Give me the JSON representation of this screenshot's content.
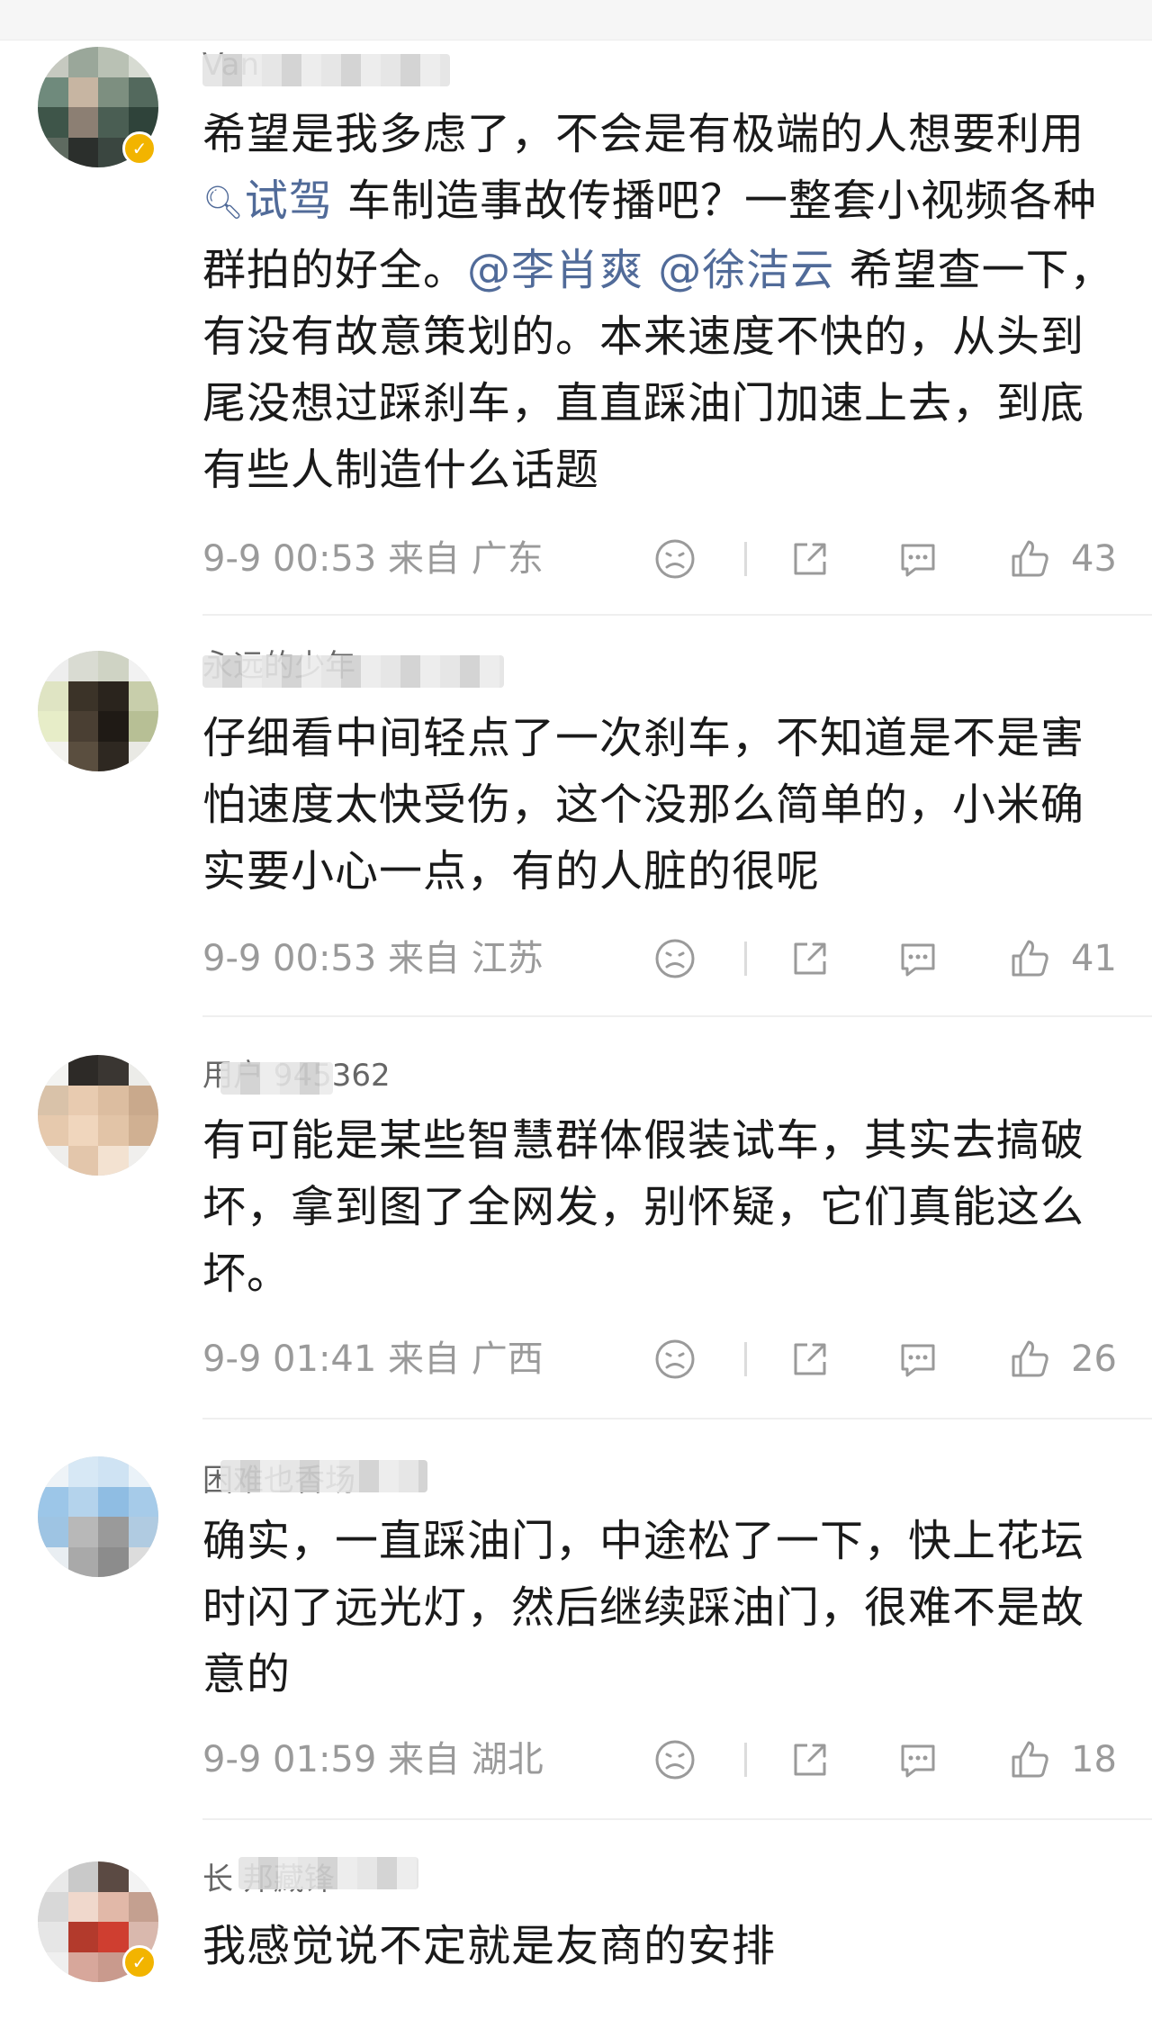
{
  "comments": [
    {
      "username_visible": "Van",
      "verified": true,
      "segments": [
        {
          "type": "text",
          "value": "希望是我多虑了，不会是有极端的人想要利用"
        },
        {
          "type": "topic",
          "value": "试驾"
        },
        {
          "type": "text",
          "value": " 车制造事故传播吧？一整套小视频各种群拍的好全。"
        },
        {
          "type": "mention",
          "value": "@李肖爽"
        },
        {
          "type": "text",
          "value": " "
        },
        {
          "type": "mention",
          "value": "@徐洁云"
        },
        {
          "type": "text",
          "value": " 希望查一下，有没有故意策划的。本来速度不快的，从头到尾没想过踩刹车，直直踩油门加速上去，到底有些人制造什么话题"
        }
      ],
      "time": "9-9 00:53",
      "location": "来自 广东",
      "likes": "43"
    },
    {
      "username_visible": "永远的少年",
      "verified": false,
      "segments": [
        {
          "type": "text",
          "value": "仔细看中间轻点了一次刹车，不知道是不是害怕速度太快受伤，这个没那么简单的，小米确实要小心一点，有的人脏的很呢"
        }
      ],
      "time": "9-9 00:53",
      "location": "来自 江苏",
      "likes": "41"
    },
    {
      "username_visible": "用户 945362",
      "verified": false,
      "segments": [
        {
          "type": "text",
          "value": "有可能是某些智慧群体假装试车，其实去搞破坏，拿到图了全网发，别怀疑，它们真能这么坏。"
        }
      ],
      "time": "9-9 01:41",
      "location": "来自 广西",
      "likes": "26"
    },
    {
      "username_visible": "困难也香场",
      "verified": false,
      "segments": [
        {
          "type": "text",
          "value": "确实，一直踩油门，中途松了一下，快上花坛时闪了远光灯，然后继续踩油门，很难不是故意的"
        }
      ],
      "time": "9-9 01:59",
      "location": "来自 湖北",
      "likes": "18"
    },
    {
      "username_visible": "长 邦藏锋",
      "verified": true,
      "segments": [
        {
          "type": "text",
          "value": "我感觉说不定就是友商的安排"
        }
      ],
      "time": "",
      "location": "",
      "likes": ""
    }
  ],
  "icons": {
    "dislike": "frown-icon",
    "share": "share-icon",
    "reply": "comment-icon",
    "like": "thumbs-up-icon",
    "topic": "search-icon",
    "verified": "verified-badge-icon"
  },
  "colors": {
    "link": "#516b99",
    "meta": "#9a9a9a",
    "badge": "#f2b400"
  }
}
